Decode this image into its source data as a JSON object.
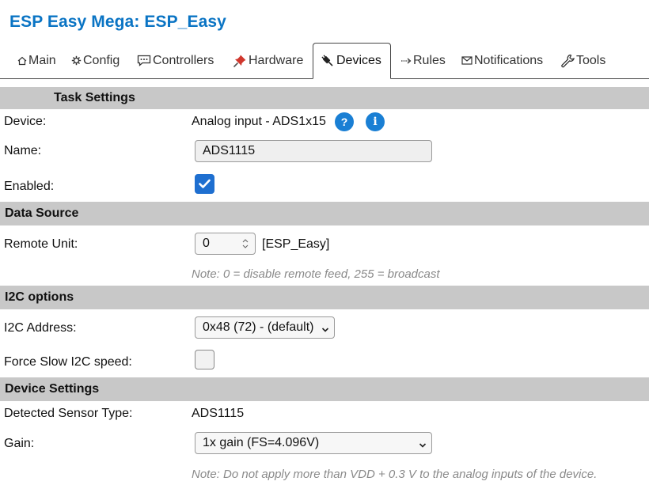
{
  "app": {
    "title": "ESP Easy Mega: ESP_Easy"
  },
  "tabs": [
    {
      "label": "Main",
      "icon": "home-icon"
    },
    {
      "label": "Config",
      "icon": "gear-icon"
    },
    {
      "label": "Controllers",
      "icon": "chat-icon"
    },
    {
      "label": "Hardware",
      "icon": "pin-icon"
    },
    {
      "label": "Devices",
      "icon": "plug-icon",
      "active": true
    },
    {
      "label": "Rules",
      "icon": "arrow-icon"
    },
    {
      "label": "Notifications",
      "icon": "envelope-icon"
    },
    {
      "label": "Tools",
      "icon": "wrench-icon"
    }
  ],
  "task_settings": {
    "header": "Task Settings",
    "device_label": "Device:",
    "device_value": "Analog input - ADS1x15",
    "help_glyph": "?",
    "info_glyph": "i",
    "name_label": "Name:",
    "name_value": "ADS1115",
    "enabled_label": "Enabled:",
    "enabled": true
  },
  "data_source": {
    "header": "Data Source",
    "remote_unit_label": "Remote Unit:",
    "remote_unit_value": "0",
    "remote_unit_name": "[ESP_Easy]",
    "note": "Note: 0 = disable remote feed, 255 = broadcast"
  },
  "i2c_options": {
    "header": "I2C options",
    "address_label": "I2C Address:",
    "address_value": "0x48 (72) - (default)",
    "slow_label": "Force Slow I2C speed:",
    "slow": false
  },
  "device_settings": {
    "header": "Device Settings",
    "sensor_type_label": "Detected Sensor Type:",
    "sensor_type_value": "ADS1115",
    "gain_label": "Gain:",
    "gain_value": "1x gain (FS=4.096V)",
    "note": "Note: Do not apply more than VDD + 0.3 V to the analog inputs of the device."
  },
  "colors": {
    "accent": "#0a74c4",
    "section_bg": "#c8c8c8",
    "checkbox": "#1e6fd0"
  }
}
